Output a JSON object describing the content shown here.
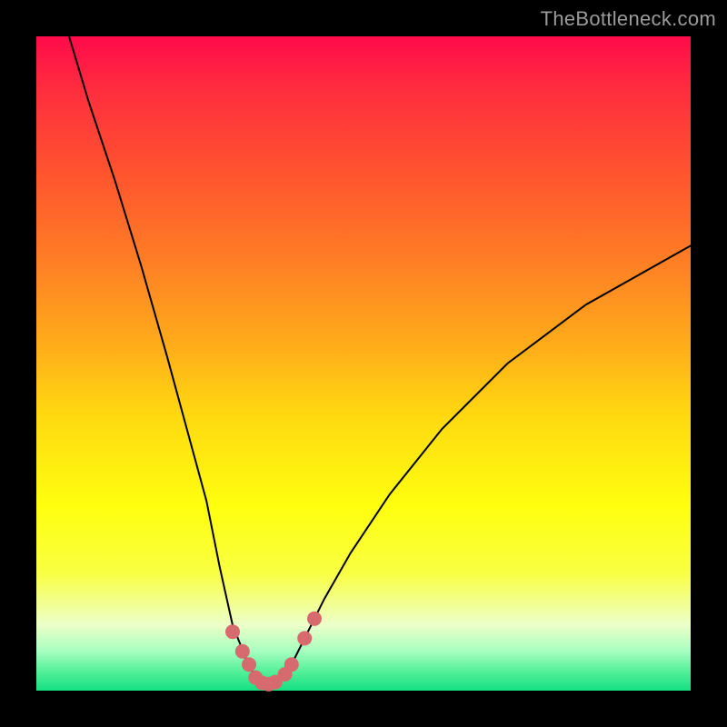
{
  "watermark": {
    "text": "TheBottleneck.com"
  },
  "chart_data": {
    "type": "line",
    "title": "",
    "xlabel": "",
    "ylabel": "",
    "xlim": [
      0,
      100
    ],
    "ylim": [
      0,
      100
    ],
    "grid": false,
    "series": [
      {
        "name": "bottleneck-curve",
        "x": [
          5,
          8,
          12,
          16,
          20,
          23,
          26,
          28,
          30,
          32,
          33,
          34,
          35,
          36,
          37,
          38,
          39,
          41,
          44,
          48,
          54,
          62,
          72,
          84,
          100
        ],
        "values": [
          100,
          90,
          78,
          65,
          51,
          40,
          29,
          19,
          10,
          5,
          3,
          1.5,
          1,
          1,
          1.5,
          2.5,
          4,
          8,
          14,
          21,
          30,
          40,
          50,
          59,
          68
        ]
      }
    ],
    "highlight_points": {
      "x": [
        30,
        31.5,
        32.5,
        33.5,
        34.5,
        35.5,
        36.5,
        38,
        39,
        41,
        42.5
      ],
      "values": [
        9,
        6,
        4,
        2,
        1.2,
        1,
        1.3,
        2.5,
        4,
        8,
        11
      ]
    },
    "colors": {
      "curve": "#000000",
      "highlight": "#d66a6e"
    }
  }
}
